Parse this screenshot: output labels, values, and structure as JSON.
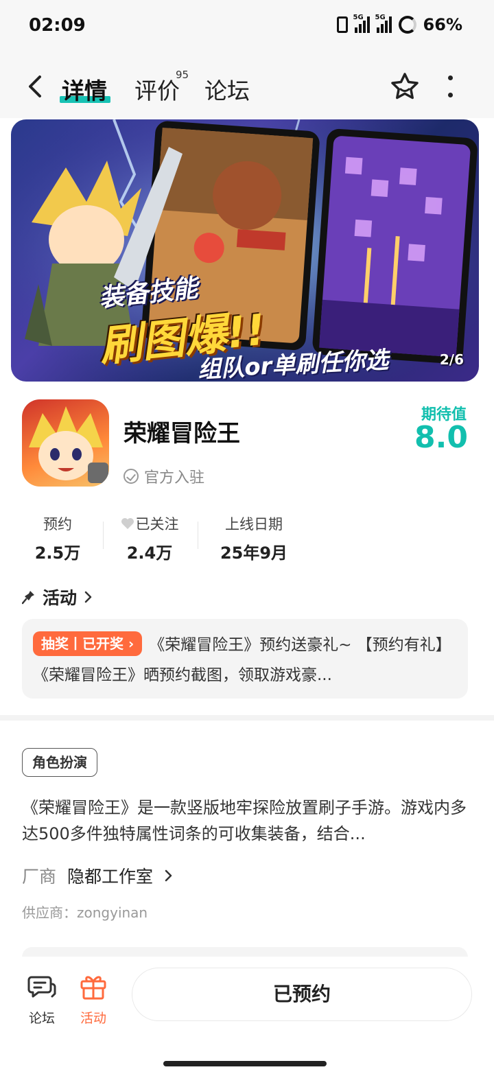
{
  "status_bar": {
    "time": "02:09",
    "signal1_tag": "5G",
    "signal2_tag": "5G",
    "battery": "66%"
  },
  "nav": {
    "tabs": [
      {
        "label": "详情"
      },
      {
        "label": "评价"
      },
      {
        "label": "论坛"
      }
    ],
    "review_count": "95"
  },
  "banner": {
    "headline1": "装备技能",
    "headline2": "刷图爆!!",
    "headline3": "组队or单刷任你选",
    "counter": "2/6"
  },
  "app": {
    "name": "荣耀冒险王",
    "official": "官方入驻",
    "expect_label": "期待值",
    "expect_value": "8.0"
  },
  "stats": [
    {
      "label": "预约",
      "value": "2.5万"
    },
    {
      "label": "已关注",
      "value": "2.4万"
    },
    {
      "label": "上线日期",
      "value": "25年9月"
    }
  ],
  "activity": {
    "title": "活动",
    "badge": "抽奖丨已开奖",
    "text": "《荣耀冒险王》预约送豪礼~ 【预约有礼】《荣耀冒险王》晒预约截图，领取游戏豪..."
  },
  "genre": "角色扮演",
  "description": "《荣耀冒险王》是一款竖版地牢探险放置刷子手游。游戏内多达500多件独特属性词条的可收集装备，结合...",
  "developer": {
    "label": "厂商",
    "name": "隐都工作室"
  },
  "supplier": "供应商：zongyinan",
  "bottom_bar": {
    "forum_label": "论坛",
    "activity_label": "活动",
    "reserve_label": "已预约"
  },
  "colors": {
    "accent": "#18c2b4",
    "activity": "#ff6a3d"
  }
}
